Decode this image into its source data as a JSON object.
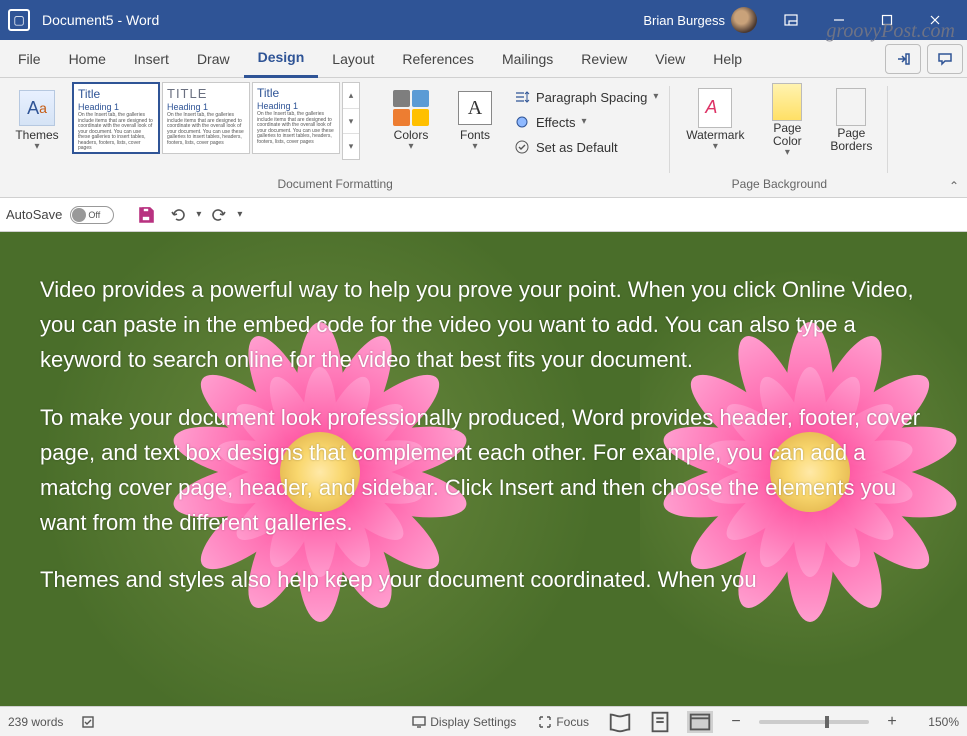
{
  "titlebar": {
    "doc_title": "Document5  -  Word",
    "user_name": "Brian Burgess"
  },
  "watermark_site": "groovyPost.com",
  "menubar": {
    "tabs": [
      "File",
      "Home",
      "Insert",
      "Draw",
      "Design",
      "Layout",
      "References",
      "Mailings",
      "Review",
      "View",
      "Help"
    ],
    "active_index": 4
  },
  "ribbon": {
    "themes_label": "Themes",
    "gallery": {
      "cards": [
        {
          "title": "Title",
          "heading": "Heading 1"
        },
        {
          "title": "TITLE",
          "heading": "Heading 1"
        },
        {
          "title": "Title",
          "heading": "Heading 1"
        }
      ],
      "body_filler": "On the Insert tab, the galleries include items that are designed to coordinate with the overall look of your document. You can use these galleries to insert tables, headers, footers, lists, cover pages"
    },
    "colors_label": "Colors",
    "fonts_label": "Fonts",
    "commands": {
      "paragraph_spacing": "Paragraph Spacing",
      "effects": "Effects",
      "set_default": "Set as Default"
    },
    "group_doc_formatting": "Document Formatting",
    "watermark_label": "Watermark",
    "page_color_label": "Page Color",
    "page_borders_label": "Page Borders",
    "group_page_bg": "Page Background"
  },
  "qat": {
    "autosave_label": "AutoSave",
    "autosave_state": "Off"
  },
  "document": {
    "paragraphs": [
      "Video provides a powerful way to help you prove your point. When you click Online Video, you can paste in the embed code for the video you want to add. You can also type a keyword to search online for the video that best fits your document.",
      "To make your document look professionally produced, Word provides header, footer, cover page, and text box designs that complement each other. For example, you can add a matchg cover page, header, and sidebar. Click Insert and then choose the elements you want from the different galleries.",
      "Themes and styles also help keep your document coordinated. When you"
    ]
  },
  "statusbar": {
    "word_count": "239 words",
    "display_settings": "Display Settings",
    "focus": "Focus",
    "zoom_percent": "150%"
  }
}
